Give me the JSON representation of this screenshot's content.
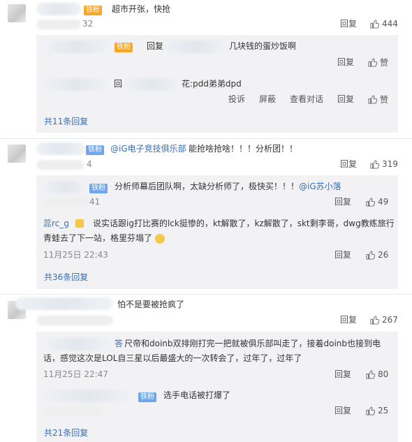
{
  "colors": {
    "accent": "#3a6fb0",
    "reply_bg": "#f2f2f5",
    "fan_badge": "#f8a72a",
    "iron_badge": "#6fa7e8"
  },
  "icons": {
    "like": "thumbs-up-icon",
    "avatar": "user-avatar"
  },
  "thread1": {
    "badge": "铁粉",
    "text": "超市开张，快抢",
    "time_tail": "32",
    "reply_label": "回复",
    "like_count": "444",
    "replies": [
      {
        "badge": "铁粉",
        "prefix": "回复",
        "text": "几块钱的蛋炒饭啊",
        "reply_label": "回复",
        "like_label": "赞"
      },
      {
        "prefix": "回",
        "text": "花:pdd弟弟dpd",
        "report": "投诉",
        "block": "屏蔽",
        "view": "查看对话",
        "reply_label": "回复",
        "like_label": "赞"
      }
    ],
    "more": "共11条回复"
  },
  "thread2": {
    "badge": "铁粉",
    "mention": "@iG电子竞技俱乐部",
    "text": "能抢啥抢啥！！！分析团！！",
    "time_tail": "4",
    "reply_label": "回复",
    "like_count": "319",
    "replies": [
      {
        "badge": "铁粉",
        "text": "分析师幕后团队啊，太缺分析师了，极快买！！！",
        "mention": "@iG苏小落",
        "time_tail": "41",
        "reply_label": "回复",
        "like_count": "49"
      },
      {
        "name_tail": "蕊rc_g",
        "text1": "说实话跟ig打比赛的lck挺惨的，kt解散了，kz解散了，skt剩李哥，dwg教练旅行",
        "text2": "青蛙去了下一站，格里芬塌了",
        "time": "11月25日 22:43",
        "reply_label": "回复",
        "like_count": "26"
      }
    ],
    "more": "共36条回复"
  },
  "thread3": {
    "text": "怕不是要被抢疯了",
    "reply_label": "回复",
    "like_count": "267",
    "replies": [
      {
        "name_tail": "答",
        "text1": "尺帝和doinb双排刚打完一把就被俱乐部叫走了，接着doinb也接到电",
        "text2": "话，感觉这次是LOL自三星以后最盛大的一次转会了，过年了，过年了",
        "time": "11月25日 22:47",
        "reply_label": "回复",
        "like_count": "80"
      },
      {
        "badge": "铁粉",
        "text": "选手电话被打爆了",
        "reply_label": "回复",
        "like_count": "25"
      }
    ],
    "more": "共21条回复"
  }
}
